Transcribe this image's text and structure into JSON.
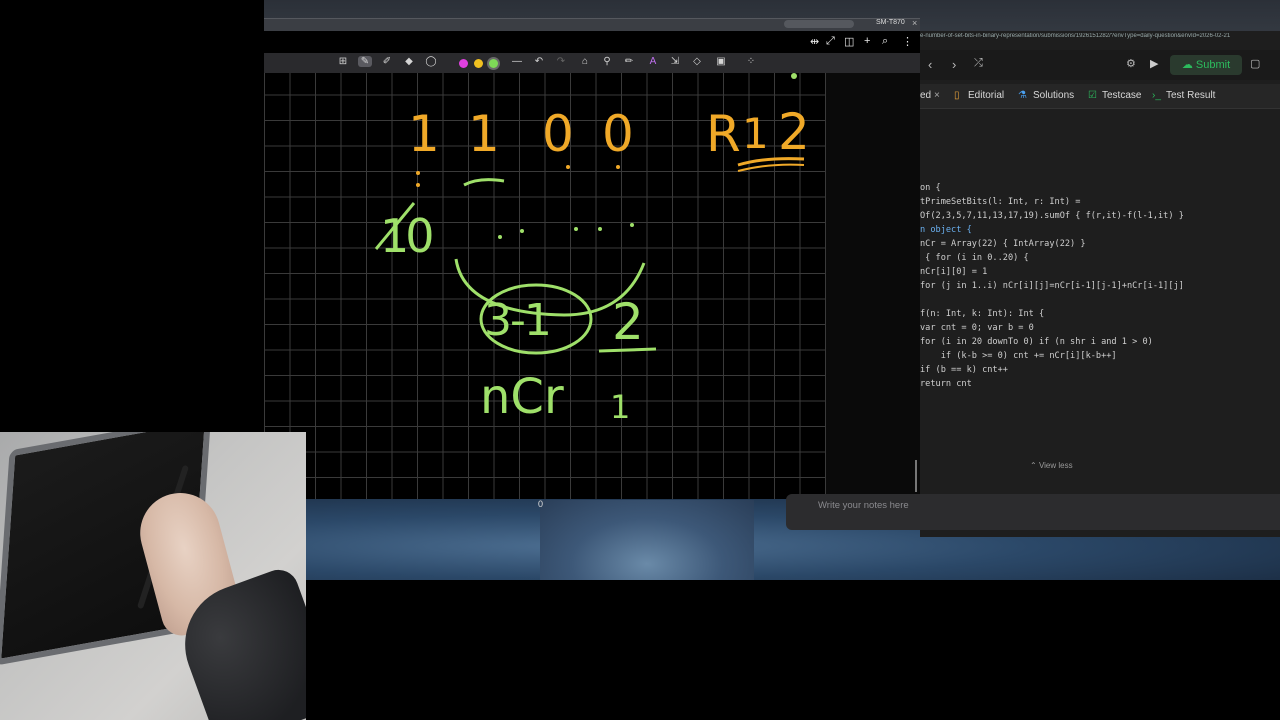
{
  "status_bar": {
    "device": "SM-T870",
    "close": "×"
  },
  "notes": {
    "title_icons": [
      "⇹",
      "⤢",
      "◫",
      "+",
      "⌕",
      "⋮"
    ],
    "toolbar": {
      "tools": [
        "⊞",
        "✎",
        "✐",
        "◆",
        "◯",
        "—",
        "↶",
        "↷",
        "⌂",
        "⚲",
        "✏",
        "A",
        "⇲",
        "◇",
        "▣",
        "⁘"
      ],
      "colors": [
        "#e040e0",
        "#f0c020",
        "#7ed957"
      ]
    },
    "handwriting": {
      "top_digits": [
        "1",
        "1",
        "0",
        "0"
      ],
      "top_right": [
        "R",
        "1",
        "2"
      ],
      "left_ten": "10",
      "circled": "3-1",
      "right_two": "2",
      "ncr": "nCr",
      "small_one": "1",
      "dots_row": "·   ·       ·   ·   ·"
    }
  },
  "leetcode": {
    "url": "e-number-of-set-bits-in-binary-representation/submissions/1926151282/?envType=daily-question&envId=2026-02-21",
    "submit_label": "Submit",
    "tabs": {
      "partial": "ed",
      "close": "×",
      "editorial": "Editorial",
      "solutions": "Solutions",
      "testcase": "Testcase",
      "test_result": "Test Result"
    },
    "code_lines": [
      "on {",
      "tPrimeSetBits(l: Int, r: Int) =",
      "Of(2,3,5,7,11,13,17,19).sumOf { f(r,it)-f(l-1,it) }",
      "n object {",
      "nCr = Array(22) { IntArray(22) }",
      " { for (i in 0..20) {",
      "nCr[i][0] = 1",
      "for (j in 1..i) nCr[i][j]=nCr[i-1][j-1]+nCr[i-1][j]",
      "",
      "f(n: Int, k: Int): Int {",
      "var cnt = 0; var b = 0",
      "for (i in 20 downTo 0) if (n shr i and 1 > 0)",
      "    if (k-b >= 0) cnt += nCr[i][k-b++]",
      "if (b == k) cnt++",
      "return cnt"
    ],
    "view_less": "View less"
  },
  "notes_bar": {
    "placeholder": "Write your notes here"
  },
  "cursor_text": "0"
}
